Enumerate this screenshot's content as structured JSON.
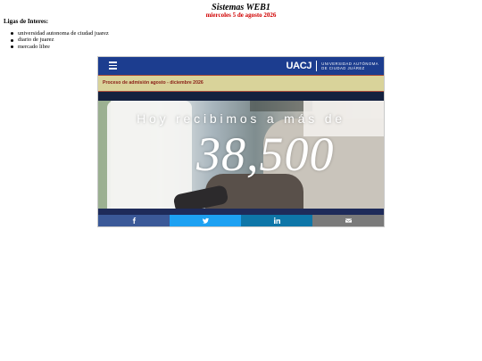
{
  "page": {
    "title": "Sistemas WEB1",
    "date": "miercoles 5 de agosto 2026",
    "links_heading": "Ligas de Interes:",
    "links": [
      "universidad autonoma de ciudad juarez",
      "diario de juarez",
      "mercado libre"
    ]
  },
  "embed": {
    "logo_mark": "UACJ",
    "logo_text_line1": "Universidad Autónoma",
    "logo_text_line2": "de Ciudad Juárez",
    "notice": "Proceso de admisión agosto - diciembre 2026",
    "hero_text": "Hoy recibimos a más de",
    "hero_number": "38,500",
    "share_icons": [
      "facebook-icon",
      "twitter-icon",
      "linkedin-icon",
      "email-icon"
    ],
    "colors": {
      "topbar": "#1c3d8f",
      "notice_bg": "#d9d39a",
      "notice_text": "#8a2018",
      "facebook": "#3b5998",
      "twitter": "#1da1f2",
      "linkedin": "#0e76a8",
      "email": "#7a7a7a"
    }
  }
}
